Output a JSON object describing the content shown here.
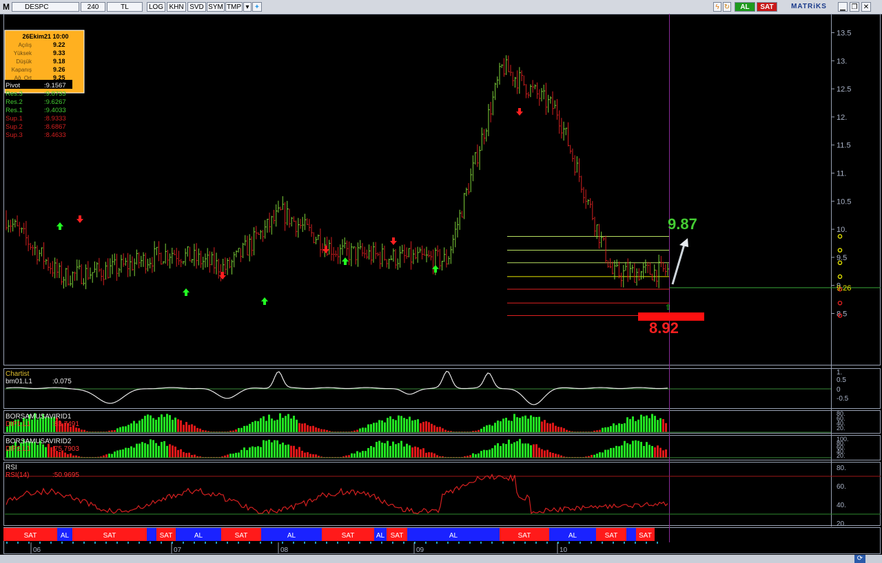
{
  "toolbar": {
    "logo": "M",
    "symbol": "DESPC",
    "period": "240",
    "currency": "TL",
    "log": "LOG",
    "khn": "KHN",
    "svd": "SVD",
    "sym": "SYM",
    "tmp": "TMP",
    "buy": "AL",
    "sell": "SAT",
    "brand": "MATRiKS",
    "icons": [
      "dropdown-arrow-icon",
      "twitter-bird-icon",
      "lightning-icon",
      "refresh-icon",
      "minimize-icon",
      "restore-icon",
      "close-icon"
    ]
  },
  "colors": {
    "up": "#7fd23a",
    "down": "#d42020",
    "grid": "#2e6e2e",
    "axis_text": "#aab4c8",
    "bar_green": "#22e622",
    "bar_red": "#e01818",
    "band_red": "#ff1a1a",
    "band_blue": "#1a22ff",
    "cursor": "#8a2a9a"
  },
  "info_box": {
    "date": "26Ekim21 10:00",
    "rows": [
      {
        "label": "Açılış",
        "value": "9.22"
      },
      {
        "label": "Yüksek",
        "value": "9.33"
      },
      {
        "label": "Düşük",
        "value": "9.18"
      },
      {
        "label": "Kapanış",
        "value": "9.26"
      },
      {
        "label": "Ağ. Ort",
        "value": "9.25"
      }
    ]
  },
  "pivot_levels": [
    {
      "label": "Pivot",
      "value": ":9.1567"
    },
    {
      "label": "Res.3",
      "value": ":9.8733"
    },
    {
      "label": "Res.2",
      "value": ":9.6267"
    },
    {
      "label": "Res.1",
      "value": ":9.4033"
    },
    {
      "label": "Sup.1",
      "value": ":8.9333"
    },
    {
      "label": "Sup.2",
      "value": ":8.6867"
    },
    {
      "label": "Sup.3",
      "value": ":8.4633"
    }
  ],
  "annotations": {
    "target": "9.87",
    "stop": "8.92",
    "last_price": "9.26"
  },
  "price_axis": [
    "13.5",
    "13.",
    "12.5",
    "12.",
    "11.5",
    "11.",
    "10.5",
    "10.",
    "9.5",
    "9.",
    "8.5"
  ],
  "panels": {
    "chartist": {
      "title": "Chartist",
      "series": "bm01.L1",
      "value": ":0.075",
      "axis": [
        "1.",
        "0.5",
        "0",
        "-0.5"
      ]
    },
    "dip1": {
      "title": "BORSAMUSAVIRID1",
      "series": "DIP1.L1",
      "value": ":83.7491",
      "axis": [
        "80.",
        "60.",
        "40.",
        "20."
      ]
    },
    "dip2": {
      "title": "BORSAMUSAVIRID2",
      "series": "DIP2.L1",
      "value": ":75.7903",
      "axis": [
        "100.",
        "80.",
        "60.",
        "40.",
        "20."
      ]
    },
    "rsi": {
      "title": "RSI",
      "series": "RSI(14)",
      "value": ":50.9695",
      "axis": [
        "80.",
        "60.",
        "40.",
        "20."
      ]
    }
  },
  "signals": [
    {
      "label": "SAT",
      "color": "red"
    },
    {
      "label": "AL",
      "color": "blue"
    },
    {
      "label": "SAT",
      "color": "red"
    },
    {
      "label": "",
      "color": "blue"
    },
    {
      "label": "SAT",
      "color": "red"
    },
    {
      "label": "AL",
      "color": "blue"
    },
    {
      "label": "SAT",
      "color": "red"
    },
    {
      "label": "AL",
      "color": "blue"
    },
    {
      "label": "SAT",
      "color": "red"
    },
    {
      "label": "AL",
      "color": "blue"
    },
    {
      "label": "SAT",
      "color": "red"
    },
    {
      "label": "AL",
      "color": "blue"
    },
    {
      "label": "SAT",
      "color": "red"
    },
    {
      "label": "AL",
      "color": "blue"
    },
    {
      "label": "SAT",
      "color": "red"
    },
    {
      "label": "",
      "color": "blue"
    },
    {
      "label": "SAT",
      "color": "red"
    }
  ],
  "months": [
    "06",
    "07",
    "08",
    "09",
    "10"
  ],
  "chart_data": {
    "type": "line",
    "title": "DESPC",
    "ylim": [
      8.3,
      13.6
    ],
    "x": [
      "06",
      "07",
      "08",
      "09",
      "10"
    ],
    "series": [
      {
        "name": "DESPC",
        "values": [
          10.2,
          9.15,
          9.3,
          9.6,
          9.3,
          10.3,
          9.6,
          9.5,
          9.45,
          12.9,
          12.1,
          9.2,
          9.26
        ]
      }
    ],
    "pivot_lines": [
      9.8733,
      9.6267,
      9.4033,
      9.1567,
      8.9333,
      8.6867,
      8.4633
    ],
    "last": 9.26,
    "target": 9.87,
    "stop": 8.92
  }
}
